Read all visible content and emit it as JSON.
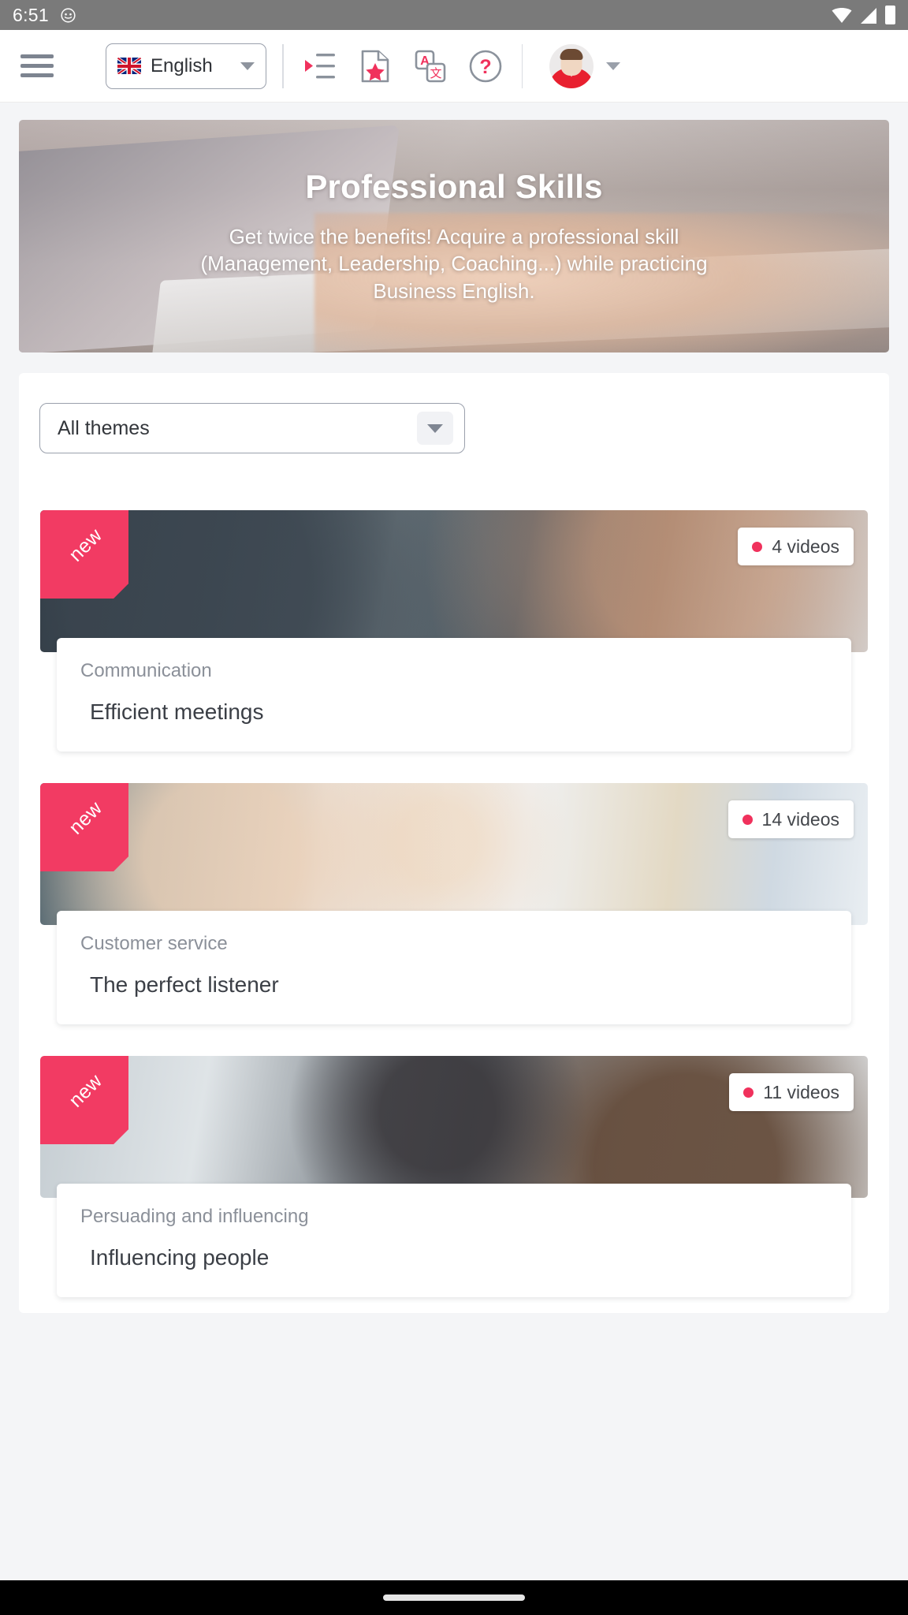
{
  "status_bar": {
    "time": "6:51",
    "emoji_icon": "face-emoji-icon",
    "wifi_icon": "wifi-icon",
    "signal_icon": "cellular-signal-icon",
    "battery_icon": "battery-icon"
  },
  "app_bar": {
    "menu_icon": "hamburger-menu-icon",
    "language": {
      "label": "English",
      "flag": "uk-flag-icon",
      "caret": "chevron-down-icon"
    },
    "tools": [
      {
        "name": "playlist-icon",
        "label": "Playlist"
      },
      {
        "name": "document-star-icon",
        "label": "Favourites"
      },
      {
        "name": "translate-icon",
        "label": "Translate"
      },
      {
        "name": "help-icon",
        "label": "Help"
      }
    ],
    "account": {
      "avatar": "user-avatar",
      "caret": "chevron-down-icon"
    }
  },
  "hero": {
    "title": "Professional Skills",
    "subtitle": "Get twice the benefits! Acquire a professional skill (Management, Leadership, Coaching...) while practicing Business English."
  },
  "filter": {
    "selected": "All themes",
    "caret": "chevron-down-icon"
  },
  "cards": [
    {
      "ribbon": "new",
      "videos": "4 videos",
      "category": "Communication",
      "title": "Efficient meetings",
      "image": "img-meeting"
    },
    {
      "ribbon": "new",
      "videos": "14 videos",
      "category": "Customer service",
      "title": "The perfect listener",
      "image": "img-callcenter"
    },
    {
      "ribbon": "new",
      "videos": "11 videos",
      "category": "Persuading and influencing",
      "title": "Influencing people",
      "image": "img-presenting"
    }
  ],
  "colors": {
    "accent_pink": "#f23b63",
    "badge_dot": "#f0315c",
    "status_bar_bg": "#7a7a7a",
    "page_bg": "#f4f5f7"
  }
}
